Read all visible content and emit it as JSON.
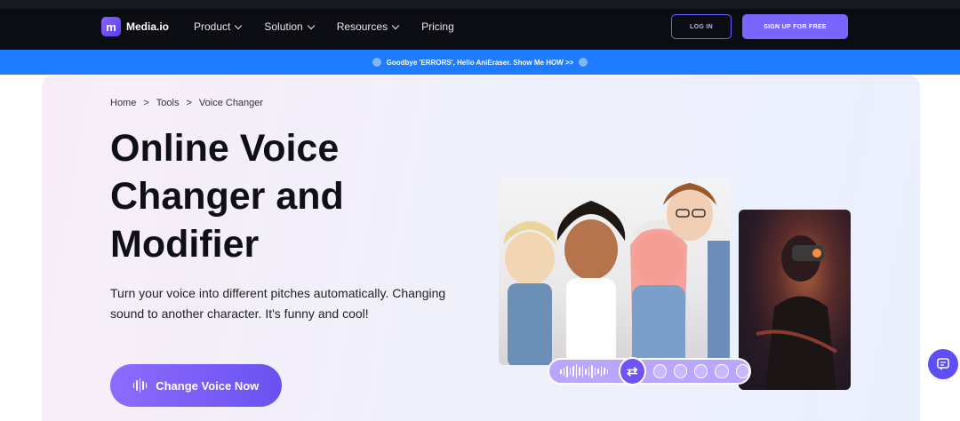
{
  "brand": {
    "name": "Media.io",
    "logo_glyph": "m"
  },
  "nav": {
    "items": [
      {
        "label": "Product",
        "dropdown": true
      },
      {
        "label": "Solution",
        "dropdown": true
      },
      {
        "label": "Resources",
        "dropdown": true
      },
      {
        "label": "Pricing",
        "dropdown": false
      }
    ],
    "login_label": "LOG IN",
    "signup_label": "SIGN UP FOR FREE"
  },
  "promo": {
    "text": "Goodbye 'ERRORS', Hello AniEraser. Show Me HOW >>"
  },
  "breadcrumb": [
    "Home",
    ">",
    "Tools",
    ">",
    "Voice Changer"
  ],
  "hero": {
    "title": "Online Voice Changer and Modifier",
    "description": "Turn your voice into different pitches automatically. Changing sound to another character. It's funny and cool!",
    "cta_label": "Change Voice Now"
  },
  "controls": {
    "swap_icon": "⇄"
  },
  "colors": {
    "accent": "#7a66ff",
    "promo": "#1f7bff",
    "nav_bg": "#0b0d12"
  }
}
